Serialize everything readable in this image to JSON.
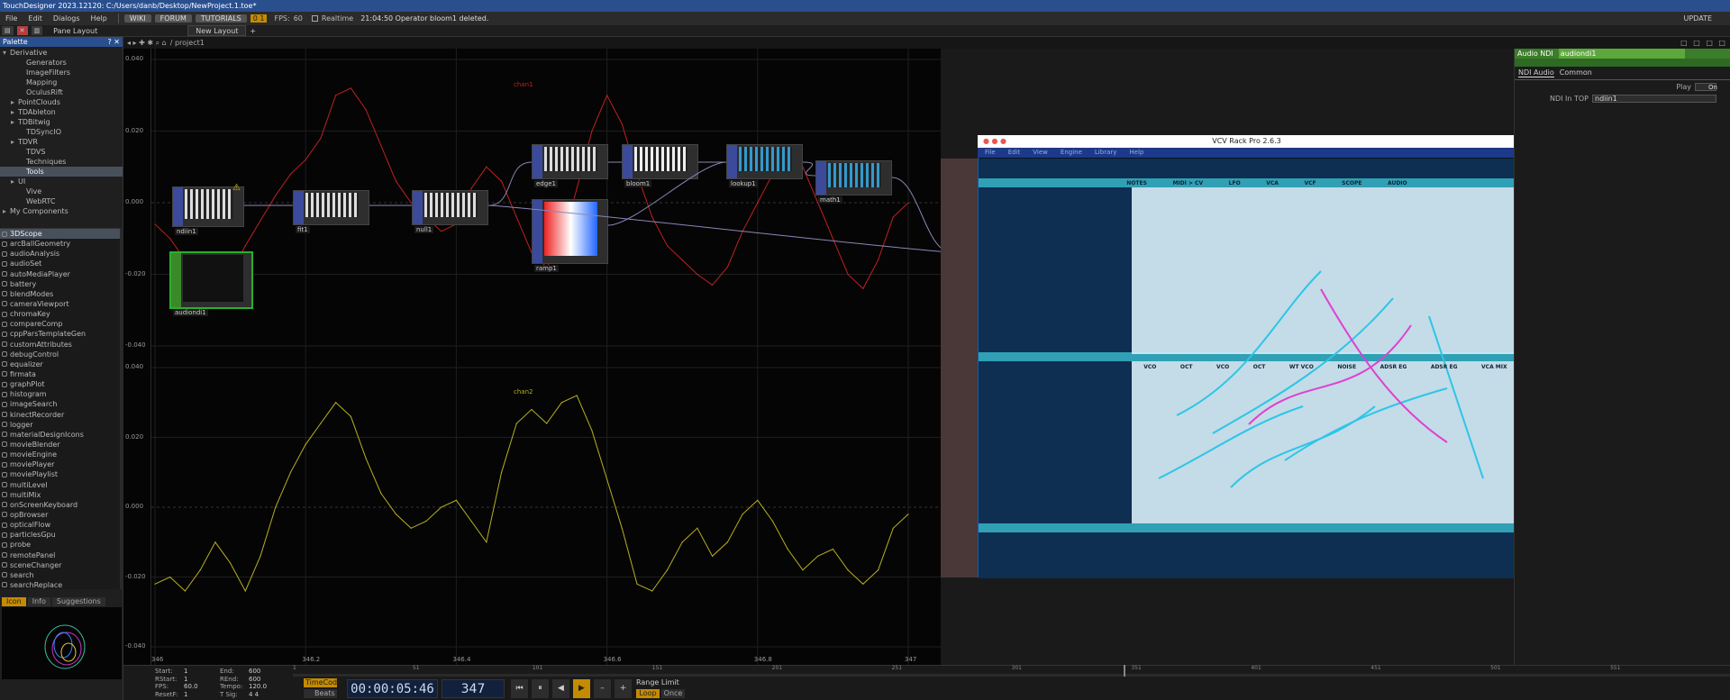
{
  "titlebar": {
    "title": "TouchDesigner 2023.12120: C:/Users/danb/Desktop/NewProject.1.toe*"
  },
  "menubar": {
    "items": [
      "File",
      "Edit",
      "Dialogs",
      "Help"
    ],
    "wiki": "WIKI",
    "forum": "FORUM",
    "tutorials": "TUTORIALS",
    "error_badge": "0 1",
    "fps_label": "FPS:",
    "fps_value": "60",
    "realtime_label": "Realtime",
    "status_message": "21:04:50 Operator bloom1 deleted.",
    "update": "UPDATE"
  },
  "toolbar": {
    "pane_layout": "Pane Layout",
    "new_layout": "New Layout",
    "plus": "+"
  },
  "netbar": {
    "path": "/ project1"
  },
  "palette": {
    "title": "Palette",
    "tree": [
      {
        "label": "Derivative",
        "expanded": true,
        "indent": 0
      },
      {
        "label": "Generators",
        "indent": 2
      },
      {
        "label": "ImageFilters",
        "indent": 2
      },
      {
        "label": "Mapping",
        "indent": 2
      },
      {
        "label": "OculusRift",
        "indent": 2
      },
      {
        "label": "PointClouds",
        "indent": 1,
        "collapsed": true
      },
      {
        "label": "TDAbleton",
        "indent": 1,
        "collapsed": true
      },
      {
        "label": "TDBitwig",
        "indent": 1,
        "collapsed": true
      },
      {
        "label": "TDSyncIO",
        "indent": 2
      },
      {
        "label": "TDVR",
        "indent": 1,
        "collapsed": true
      },
      {
        "label": "TDVS",
        "indent": 2
      },
      {
        "label": "Techniques",
        "indent": 2
      },
      {
        "label": "Tools",
        "indent": 2,
        "selected": true
      },
      {
        "label": "UI",
        "indent": 1,
        "collapsed": true
      },
      {
        "label": "Vive",
        "indent": 2
      },
      {
        "label": "WebRTC",
        "indent": 2
      },
      {
        "label": "My Components",
        "indent": 0,
        "collapsed": true
      }
    ],
    "components": [
      "3DScope",
      "arcBallGeometry",
      "audioAnalysis",
      "audioSet",
      "autoMediaPlayer",
      "battery",
      "blendModes",
      "cameraViewport",
      "chromaKey",
      "compareComp",
      "cppParsTemplateGen",
      "customAttributes",
      "debugControl",
      "equalizer",
      "firmata",
      "graphPlot",
      "histogram",
      "imageSearch",
      "kinectRecorder",
      "logger",
      "materialDesignIcons",
      "movieBlender",
      "movieEngine",
      "moviePlayer",
      "moviePlaylist",
      "multiLevel",
      "multiMix",
      "onScreenKeyboard",
      "opBrowser",
      "opticalFlow",
      "particlesGpu",
      "probe",
      "remotePanel",
      "sceneChanger",
      "search",
      "searchReplace"
    ],
    "info_tabs": [
      "Icon",
      "Info",
      "Suggestions"
    ]
  },
  "chart_data": {
    "type": "line",
    "title": "",
    "series": [
      {
        "name": "chan1",
        "color": "#c02020",
        "ylim": [
          -0.04,
          0.04
        ],
        "ticks": [
          "0.040",
          "0.020",
          "0.000",
          "-0.020",
          "-0.040"
        ],
        "x": [
          346,
          346.02,
          346.04,
          346.06,
          346.08,
          346.1,
          346.12,
          346.14,
          346.16,
          346.18,
          346.2,
          346.22,
          346.24,
          346.26,
          346.28,
          346.3,
          346.32,
          346.34,
          346.36,
          346.38,
          346.4,
          346.42,
          346.44,
          346.46,
          346.48,
          346.5,
          346.52,
          346.54,
          346.56,
          346.58,
          346.6,
          346.62,
          346.64,
          346.66,
          346.68,
          346.7,
          346.72,
          346.74,
          346.76,
          346.78,
          346.8,
          346.82,
          346.84,
          346.86,
          346.88,
          346.9,
          346.92,
          346.94,
          346.96,
          346.98,
          347
        ],
        "values": [
          -0.006,
          -0.01,
          -0.016,
          -0.022,
          -0.024,
          -0.02,
          -0.012,
          -0.005,
          0.002,
          0.008,
          0.012,
          0.018,
          0.03,
          0.032,
          0.026,
          0.016,
          0.006,
          0.0,
          -0.004,
          -0.008,
          -0.006,
          0.004,
          0.01,
          0.006,
          -0.004,
          -0.014,
          -0.018,
          -0.012,
          0.004,
          0.02,
          0.03,
          0.022,
          0.008,
          -0.004,
          -0.012,
          -0.016,
          -0.02,
          -0.023,
          -0.018,
          -0.008,
          0.0,
          0.008,
          0.014,
          0.01,
          0.0,
          -0.01,
          -0.02,
          -0.024,
          -0.016,
          -0.004,
          0.0
        ]
      },
      {
        "name": "chan2",
        "color": "#b8b020",
        "ylim": [
          -0.04,
          0.04
        ],
        "ticks": [
          "0.040",
          "0.020",
          "0.000",
          "-0.020",
          "-0.040"
        ],
        "x": [
          346,
          346.02,
          346.04,
          346.06,
          346.08,
          346.1,
          346.12,
          346.14,
          346.16,
          346.18,
          346.2,
          346.22,
          346.24,
          346.26,
          346.28,
          346.3,
          346.32,
          346.34,
          346.36,
          346.38,
          346.4,
          346.42,
          346.44,
          346.46,
          346.48,
          346.5,
          346.52,
          346.54,
          346.56,
          346.58,
          346.6,
          346.62,
          346.64,
          346.66,
          346.68,
          346.7,
          346.72,
          346.74,
          346.76,
          346.78,
          346.8,
          346.82,
          346.84,
          346.86,
          346.88,
          346.9,
          346.92,
          346.94,
          346.96,
          346.98,
          347
        ],
        "values": [
          -0.022,
          -0.02,
          -0.024,
          -0.018,
          -0.01,
          -0.016,
          -0.024,
          -0.014,
          0.0,
          0.01,
          0.018,
          0.024,
          0.03,
          0.026,
          0.014,
          0.004,
          -0.002,
          -0.006,
          -0.004,
          0.0,
          0.002,
          -0.004,
          -0.01,
          0.01,
          0.024,
          0.028,
          0.024,
          0.03,
          0.032,
          0.022,
          0.008,
          -0.006,
          -0.022,
          -0.024,
          -0.018,
          -0.01,
          -0.006,
          -0.014,
          -0.01,
          -0.002,
          0.002,
          -0.004,
          -0.012,
          -0.018,
          -0.014,
          -0.012,
          -0.018,
          -0.022,
          -0.018,
          -0.006,
          -0.002
        ]
      }
    ],
    "xticks": [
      "346",
      "346.2",
      "346.4",
      "346.6",
      "346.8",
      "347"
    ],
    "xlim": [
      346,
      347
    ],
    "grid": true
  },
  "nodes": [
    {
      "name": "ndiin1"
    },
    {
      "name": "fit1"
    },
    {
      "name": "null1"
    },
    {
      "name": "edge1"
    },
    {
      "name": "bloom1"
    },
    {
      "name": "lookup1"
    },
    {
      "name": "math1"
    },
    {
      "name": "ramp1"
    },
    {
      "name": "comp1"
    },
    {
      "name": "audiondi1"
    }
  ],
  "vcv": {
    "title": "VCV Rack Pro 2.6.3",
    "menu": [
      "File",
      "Edit",
      "View",
      "Engine",
      "Library",
      "Help"
    ],
    "modules_top": [
      "NOTES",
      "MIDI > CV",
      "LFO",
      "VCA",
      "VCF",
      "SCOPE",
      "AUDIO"
    ],
    "modules_bottom": [
      "VCO",
      "OCT",
      "VCO",
      "OCT",
      "WT VCO",
      "NOISE",
      "ADSR EG",
      "ADSR EG",
      "VCA MIX"
    ]
  },
  "params": {
    "type": "Audio NDI",
    "name": "audiondi1",
    "tabs": [
      "NDI Audio",
      "Common"
    ],
    "rows": [
      {
        "label": "Play",
        "value": "On",
        "kind": "toggle"
      },
      {
        "label": "NDI In TOP",
        "value": "ndiin1",
        "kind": "text"
      }
    ]
  },
  "timebar": {
    "rows": [
      {
        "k": "Start:",
        "v": "1",
        "k2": "End:",
        "v2": "600"
      },
      {
        "k": "RStart:",
        "v": "1",
        "k2": "REnd:",
        "v2": "600"
      },
      {
        "k": "FPS:",
        "v": "60.0",
        "k2": "Tempo:",
        "v2": "120.0"
      },
      {
        "k": "ResetF:",
        "v": "1",
        "k2": "T Sig:",
        "v2": "4   4"
      }
    ],
    "timecode_label": "TimeCode",
    "beats_label": "Beats",
    "timecode": "00:00:05:46",
    "frame": "347",
    "range_limit": "Range Limit",
    "loop": "Loop",
    "once": "Once",
    "ruler": [
      "1",
      "51",
      "101",
      "151",
      "201",
      "251",
      "301",
      "351",
      "401",
      "451",
      "501",
      "551",
      "600"
    ]
  }
}
